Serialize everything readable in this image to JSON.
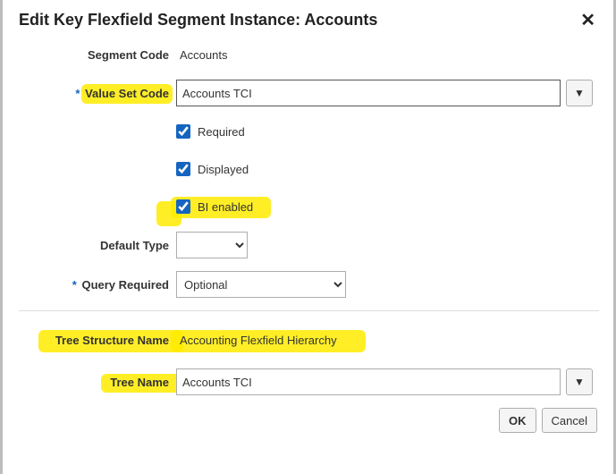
{
  "dialog": {
    "title": "Edit Key Flexfield Segment Instance: Accounts"
  },
  "labels": {
    "segment_code": "Segment Code",
    "value_set_code": "Value Set Code",
    "required": "Required",
    "displayed": "Displayed",
    "bi_enabled": "BI enabled",
    "default_type": "Default Type",
    "query_required": "Query Required",
    "tree_structure_name": "Tree Structure Name",
    "tree_name": "Tree Name"
  },
  "values": {
    "segment_code": "Accounts",
    "value_set_code": "Accounts TCI",
    "required_checked": true,
    "displayed_checked": true,
    "bi_enabled_checked": true,
    "default_type": "",
    "query_required": "Optional",
    "tree_structure_name": "Accounting Flexfield Hierarchy",
    "tree_name": "Accounts TCI"
  },
  "buttons": {
    "ok": "OK",
    "cancel": "Cancel"
  }
}
